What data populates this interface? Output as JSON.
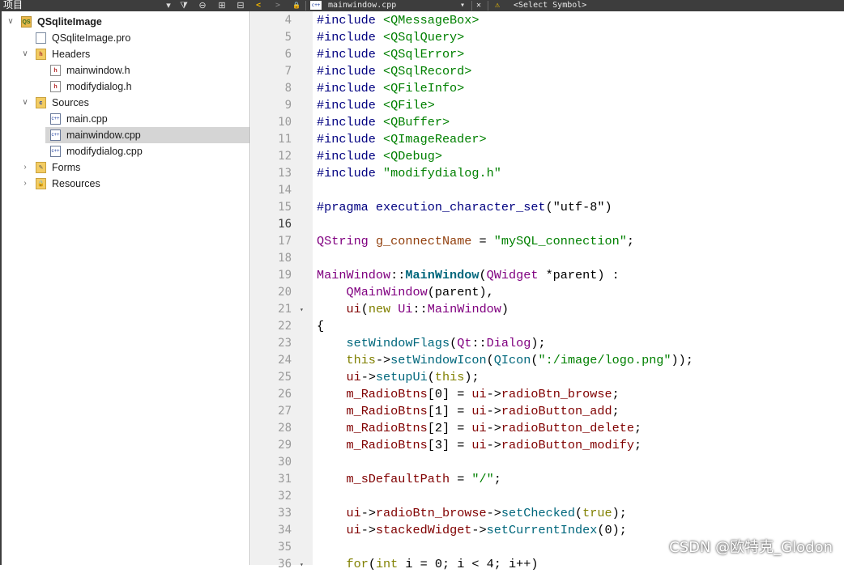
{
  "left_panel": {
    "title": "项目",
    "toolbar": {
      "dropdown": "▾",
      "filter": "⧩",
      "link": "⊖",
      "split": "⊞",
      "close": "⊟"
    }
  },
  "tree": [
    {
      "label": "QSqliteImage",
      "arrow": "∨",
      "icon": "QS",
      "bold": true
    },
    {
      "label": "QSqliteImage.pro",
      "arrow": "",
      "icon": ""
    },
    {
      "label": "Headers",
      "arrow": "∨",
      "icon": "h"
    },
    {
      "label": "mainwindow.h",
      "arrow": "",
      "icon": "h"
    },
    {
      "label": "modifydialog.h",
      "arrow": "",
      "icon": "h"
    },
    {
      "label": "Sources",
      "arrow": "∨",
      "icon": "c"
    },
    {
      "label": "main.cpp",
      "arrow": "",
      "icon": "c++"
    },
    {
      "label": "mainwindow.cpp",
      "arrow": "",
      "icon": "c++",
      "selected": true
    },
    {
      "label": "modifydialog.cpp",
      "arrow": "",
      "icon": "c++"
    },
    {
      "label": "Forms",
      "arrow": "›",
      "icon": "✎"
    },
    {
      "label": "Resources",
      "arrow": "›",
      "icon": "🔒"
    }
  ],
  "editor_toolbar": {
    "back": "<",
    "forward": ">",
    "lock": "🔒",
    "file_icon": "c++",
    "file_name": "mainwindow.cpp",
    "dropdown": "▾",
    "close": "✕",
    "warning": "⚠",
    "symbol": "<Select Symbol>"
  },
  "code": {
    "line_numbers": [
      "4",
      "5",
      "6",
      "7",
      "8",
      "9",
      "10",
      "11",
      "12",
      "13",
      "14",
      "15",
      "16",
      "17",
      "18",
      "19",
      "20",
      "21",
      "22",
      "23",
      "24",
      "25",
      "26",
      "27",
      "28",
      "29",
      "30",
      "31",
      "32",
      "33",
      "34",
      "35",
      "36"
    ],
    "current_line": "16",
    "fold_marker": "▾",
    "lines": [
      [
        {
          "t": "#include",
          "c": "k-pre"
        },
        {
          "t": " <QMessageBox>",
          "c": "k-str"
        }
      ],
      [
        {
          "t": "#include",
          "c": "k-pre"
        },
        {
          "t": " <QSqlQuery>",
          "c": "k-str"
        }
      ],
      [
        {
          "t": "#include",
          "c": "k-pre"
        },
        {
          "t": " <QSqlError>",
          "c": "k-str"
        }
      ],
      [
        {
          "t": "#include",
          "c": "k-pre"
        },
        {
          "t": " <QSqlRecord>",
          "c": "k-str"
        }
      ],
      [
        {
          "t": "#include",
          "c": "k-pre"
        },
        {
          "t": " <QFileInfo>",
          "c": "k-str"
        }
      ],
      [
        {
          "t": "#include",
          "c": "k-pre"
        },
        {
          "t": " <QFile>",
          "c": "k-str"
        }
      ],
      [
        {
          "t": "#include",
          "c": "k-pre"
        },
        {
          "t": " <QBuffer>",
          "c": "k-str"
        }
      ],
      [
        {
          "t": "#include",
          "c": "k-pre"
        },
        {
          "t": " <QImageReader>",
          "c": "k-str"
        }
      ],
      [
        {
          "t": "#include",
          "c": "k-pre"
        },
        {
          "t": " <QDebug>",
          "c": "k-str"
        }
      ],
      [
        {
          "t": "#include",
          "c": "k-pre"
        },
        {
          "t": " \"modifydialog.h\"",
          "c": "k-str"
        }
      ],
      [],
      [
        {
          "t": "#pragma",
          "c": "k-pre"
        },
        {
          "t": " execution_character_set",
          "c": "k-pre"
        },
        {
          "t": "(",
          "c": ""
        },
        {
          "t": "\"utf-8\"",
          "c": ""
        },
        {
          "t": ")",
          "c": ""
        }
      ],
      [],
      [
        {
          "t": "QString",
          "c": "k-type"
        },
        {
          "t": " ",
          "c": ""
        },
        {
          "t": "g_connectName",
          "c": "k-var"
        },
        {
          "t": " = ",
          "c": ""
        },
        {
          "t": "\"mySQL_connection\"",
          "c": "k-str"
        },
        {
          "t": ";",
          "c": ""
        }
      ],
      [],
      [
        {
          "t": "MainWindow",
          "c": "k-type"
        },
        {
          "t": "::",
          "c": ""
        },
        {
          "t": "MainWindow",
          "c": "k-bold"
        },
        {
          "t": "(",
          "c": ""
        },
        {
          "t": "QWidget",
          "c": "k-type"
        },
        {
          "t": " *parent) :",
          "c": ""
        }
      ],
      [
        {
          "t": "    ",
          "c": ""
        },
        {
          "t": "QMainWindow",
          "c": "k-type"
        },
        {
          "t": "(parent),",
          "c": ""
        }
      ],
      [
        {
          "t": "    ",
          "c": ""
        },
        {
          "t": "ui",
          "c": "k-mem"
        },
        {
          "t": "(",
          "c": ""
        },
        {
          "t": "new",
          "c": "k-kw"
        },
        {
          "t": " ",
          "c": ""
        },
        {
          "t": "Ui",
          "c": "k-type"
        },
        {
          "t": "::",
          "c": ""
        },
        {
          "t": "MainWindow",
          "c": "k-type"
        },
        {
          "t": ")",
          "c": ""
        }
      ],
      [
        {
          "t": "{",
          "c": ""
        }
      ],
      [
        {
          "t": "    ",
          "c": ""
        },
        {
          "t": "setWindowFlags",
          "c": "k-call"
        },
        {
          "t": "(",
          "c": ""
        },
        {
          "t": "Qt",
          "c": "k-type"
        },
        {
          "t": "::",
          "c": ""
        },
        {
          "t": "Dialog",
          "c": "k-type"
        },
        {
          "t": ");",
          "c": ""
        }
      ],
      [
        {
          "t": "    ",
          "c": ""
        },
        {
          "t": "this",
          "c": "k-kw"
        },
        {
          "t": "->",
          "c": ""
        },
        {
          "t": "setWindowIcon",
          "c": "k-call"
        },
        {
          "t": "(",
          "c": ""
        },
        {
          "t": "QIcon",
          "c": "k-call"
        },
        {
          "t": "(",
          "c": ""
        },
        {
          "t": "\":/image/logo.png\"",
          "c": "k-str"
        },
        {
          "t": "));",
          "c": ""
        }
      ],
      [
        {
          "t": "    ",
          "c": ""
        },
        {
          "t": "ui",
          "c": "k-mem"
        },
        {
          "t": "->",
          "c": ""
        },
        {
          "t": "setupUi",
          "c": "k-call"
        },
        {
          "t": "(",
          "c": ""
        },
        {
          "t": "this",
          "c": "k-kw"
        },
        {
          "t": ");",
          "c": ""
        }
      ],
      [
        {
          "t": "    ",
          "c": ""
        },
        {
          "t": "m_RadioBtns",
          "c": "k-mem"
        },
        {
          "t": "[0] = ",
          "c": ""
        },
        {
          "t": "ui",
          "c": "k-mem"
        },
        {
          "t": "->",
          "c": ""
        },
        {
          "t": "radioBtn_browse",
          "c": "k-mem"
        },
        {
          "t": ";",
          "c": ""
        }
      ],
      [
        {
          "t": "    ",
          "c": ""
        },
        {
          "t": "m_RadioBtns",
          "c": "k-mem"
        },
        {
          "t": "[1] = ",
          "c": ""
        },
        {
          "t": "ui",
          "c": "k-mem"
        },
        {
          "t": "->",
          "c": ""
        },
        {
          "t": "radioButton_add",
          "c": "k-mem"
        },
        {
          "t": ";",
          "c": ""
        }
      ],
      [
        {
          "t": "    ",
          "c": ""
        },
        {
          "t": "m_RadioBtns",
          "c": "k-mem"
        },
        {
          "t": "[2] = ",
          "c": ""
        },
        {
          "t": "ui",
          "c": "k-mem"
        },
        {
          "t": "->",
          "c": ""
        },
        {
          "t": "radioButton_delete",
          "c": "k-mem"
        },
        {
          "t": ";",
          "c": ""
        }
      ],
      [
        {
          "t": "    ",
          "c": ""
        },
        {
          "t": "m_RadioBtns",
          "c": "k-mem"
        },
        {
          "t": "[3] = ",
          "c": ""
        },
        {
          "t": "ui",
          "c": "k-mem"
        },
        {
          "t": "->",
          "c": ""
        },
        {
          "t": "radioButton_modify",
          "c": "k-mem"
        },
        {
          "t": ";",
          "c": ""
        }
      ],
      [],
      [
        {
          "t": "    ",
          "c": ""
        },
        {
          "t": "m_sDefaultPath",
          "c": "k-mem"
        },
        {
          "t": " = ",
          "c": ""
        },
        {
          "t": "\"/\"",
          "c": "k-str"
        },
        {
          "t": ";",
          "c": ""
        }
      ],
      [],
      [
        {
          "t": "    ",
          "c": ""
        },
        {
          "t": "ui",
          "c": "k-mem"
        },
        {
          "t": "->",
          "c": ""
        },
        {
          "t": "radioBtn_browse",
          "c": "k-mem"
        },
        {
          "t": "->",
          "c": ""
        },
        {
          "t": "setChecked",
          "c": "k-call"
        },
        {
          "t": "(",
          "c": ""
        },
        {
          "t": "true",
          "c": "k-kw"
        },
        {
          "t": ");",
          "c": ""
        }
      ],
      [
        {
          "t": "    ",
          "c": ""
        },
        {
          "t": "ui",
          "c": "k-mem"
        },
        {
          "t": "->",
          "c": ""
        },
        {
          "t": "stackedWidget",
          "c": "k-mem"
        },
        {
          "t": "->",
          "c": ""
        },
        {
          "t": "setCurrentIndex",
          "c": "k-call"
        },
        {
          "t": "(0);",
          "c": ""
        }
      ],
      [],
      [
        {
          "t": "    ",
          "c": ""
        },
        {
          "t": "for",
          "c": "k-kw"
        },
        {
          "t": "(",
          "c": ""
        },
        {
          "t": "int",
          "c": "k-kw"
        },
        {
          "t": " i = 0; i < 4; i++)",
          "c": ""
        }
      ]
    ]
  },
  "watermark": "CSDN @欧特克_Glodon"
}
